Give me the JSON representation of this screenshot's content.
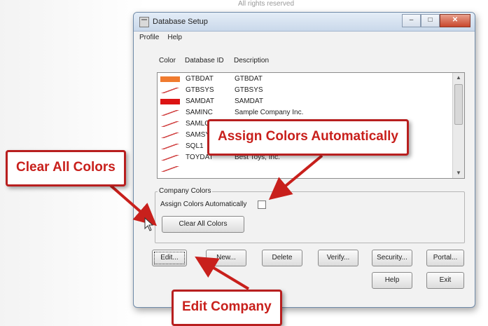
{
  "background_text": "All rights reserved",
  "window": {
    "title": "Database Setup",
    "controls": {
      "minimize": "–",
      "maximize": "□",
      "close": "✕"
    }
  },
  "menu": [
    "Profile",
    "Help"
  ],
  "columns": {
    "color": "Color",
    "database_id": "Database ID",
    "description": "Description"
  },
  "rows": [
    {
      "swatch": "#f07b2f",
      "id": "GTBDAT",
      "desc": "GTBDAT"
    },
    {
      "swatch": "none",
      "id": "GTBSYS",
      "desc": "GTBSYS"
    },
    {
      "swatch": "#dc1414",
      "id": "SAMDAT",
      "desc": "SAMDAT"
    },
    {
      "swatch": "none",
      "id": "SAMINC",
      "desc": "Sample Company Inc."
    },
    {
      "swatch": "none",
      "id": "SAMLO",
      "desc": ""
    },
    {
      "swatch": "none",
      "id": "SAMSYS",
      "desc": ""
    },
    {
      "swatch": "none",
      "id": "SQL1",
      "desc": ""
    },
    {
      "swatch": "none",
      "id": "TOYDAT",
      "desc": "Best Toys, Inc."
    },
    {
      "swatch": "none",
      "id": "",
      "desc": ""
    }
  ],
  "company_colors": {
    "group_label": "Company Colors",
    "assign_label": "Assign Colors Automatically",
    "clear_button": "Clear All Colors"
  },
  "buttons": {
    "edit": "Edit...",
    "new": "New...",
    "delete": "Delete",
    "verify": "Verify...",
    "security": "Security...",
    "portal": "Portal...",
    "help": "Help",
    "exit": "Exit"
  },
  "callouts": {
    "assign": "Assign Colors Automatically",
    "clear": "Clear All Colors",
    "edit": "Edit Company"
  },
  "colors": {
    "callout_red": "#c8201c",
    "accent_orange": "#f07b2f",
    "accent_red": "#dc1414"
  }
}
